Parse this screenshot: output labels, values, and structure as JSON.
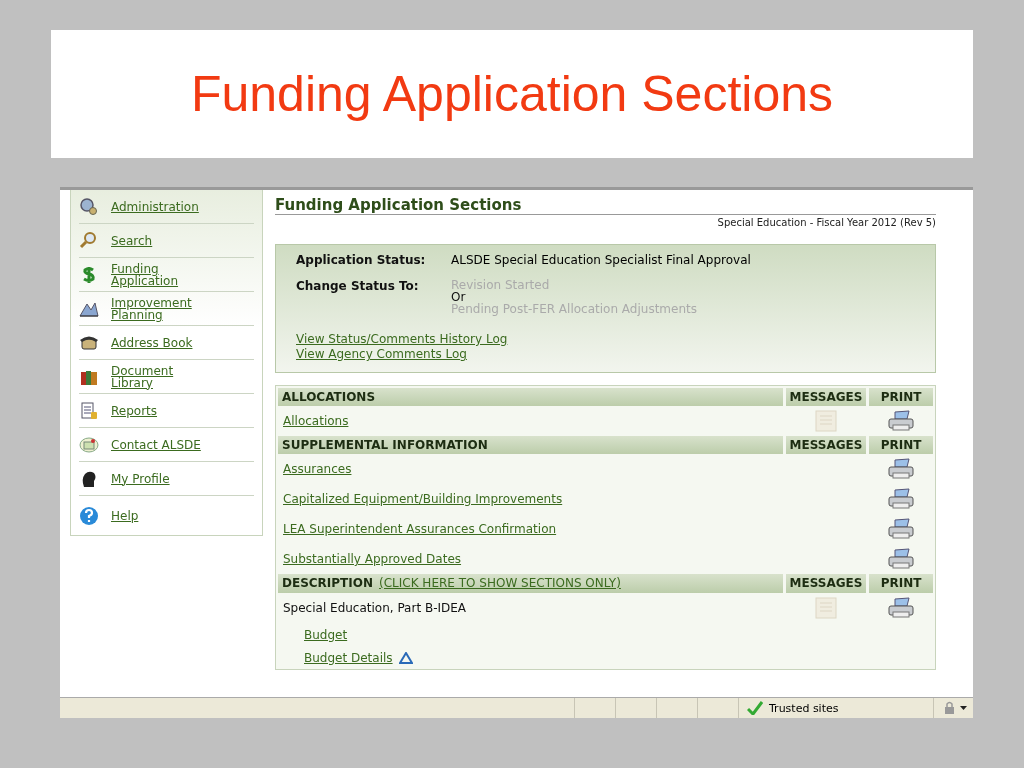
{
  "slide_title": "Funding Application Sections",
  "sidebar": {
    "items": [
      {
        "label": "Administration"
      },
      {
        "label": "Search"
      },
      {
        "label": "Funding Application"
      },
      {
        "label": "Improvement Planning"
      },
      {
        "label": "Address Book"
      },
      {
        "label": "Document Library"
      },
      {
        "label": "Reports"
      },
      {
        "label": "Contact ALSDE"
      },
      {
        "label": "My Profile"
      },
      {
        "label": "Help"
      }
    ]
  },
  "page_title": "Funding Application Sections",
  "subtitle": "Special Education - Fiscal Year 2012 (Rev 5)",
  "status_panel": {
    "status_label": "Application Status:",
    "status_value": "ALSDE Special Education Specialist Final Approval",
    "change_label": "Change Status To:",
    "options": [
      {
        "text": "Revision Started",
        "disabled": true
      },
      {
        "text": "Or",
        "disabled": false
      },
      {
        "text": "Pending Post-FER Allocation Adjustments",
        "disabled": true
      }
    ],
    "links": [
      "View Status/Comments History Log",
      "View Agency Comments Log"
    ]
  },
  "sections": [
    {
      "title": "ALLOCATIONS",
      "messages_header": "MESSAGES",
      "print_header": "PRINT",
      "rows": [
        {
          "kind": "link",
          "text": "Allocations",
          "messages": true,
          "print": true,
          "flag": false
        }
      ]
    },
    {
      "title": "SUPPLEMENTAL INFORMATION",
      "messages_header": "MESSAGES",
      "print_header": "PRINT",
      "rows": [
        {
          "kind": "link",
          "text": "Assurances",
          "messages": false,
          "print": true,
          "flag": false
        },
        {
          "kind": "link",
          "text": "Capitalized Equipment/Building Improvements",
          "messages": false,
          "print": true,
          "flag": false
        },
        {
          "kind": "link",
          "text": "LEA Superintendent Assurances Confirmation",
          "messages": false,
          "print": true,
          "flag": false
        },
        {
          "kind": "link",
          "text": "Substantially Approved Dates",
          "messages": false,
          "print": true,
          "flag": false
        }
      ]
    },
    {
      "title": "DESCRIPTION",
      "title_link": "(CLICK HERE TO SHOW SECTIONS ONLY)",
      "messages_header": "MESSAGES",
      "print_header": "PRINT",
      "rows": [
        {
          "kind": "text",
          "text": "Special Education, Part B-IDEA",
          "messages": true,
          "print": true,
          "flag": false
        },
        {
          "kind": "sublink",
          "text": "Budget",
          "messages": false,
          "print": false,
          "flag": false
        },
        {
          "kind": "sublink",
          "text": "Budget Details",
          "messages": false,
          "print": false,
          "flag": true
        }
      ]
    }
  ],
  "status_bar": {
    "zone": "Trusted sites"
  }
}
